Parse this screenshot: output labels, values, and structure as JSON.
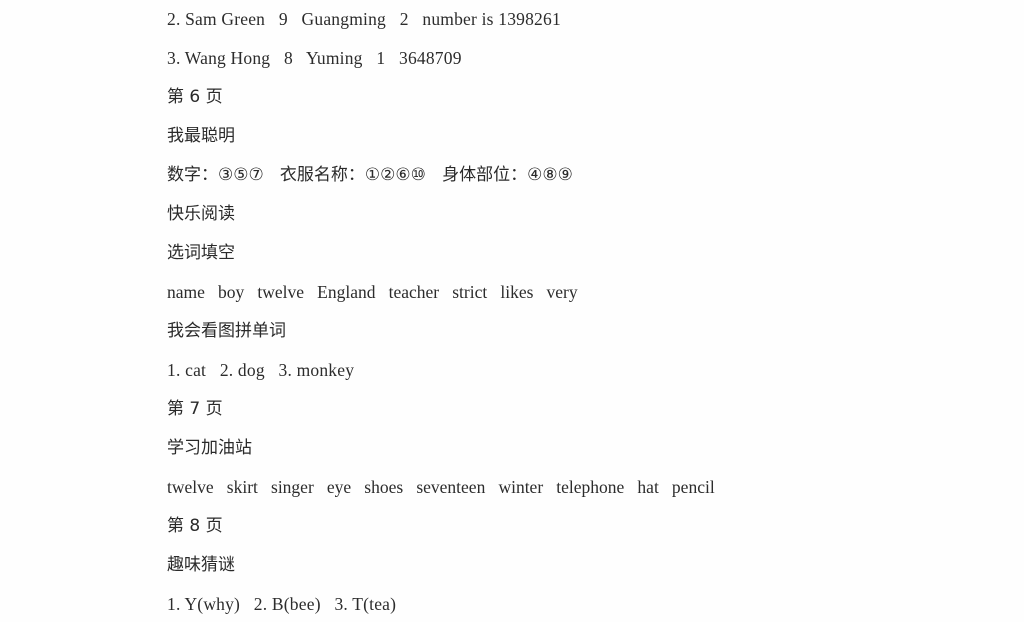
{
  "document": {
    "background_color": "#fefefe",
    "text_color": "#2b2b2b",
    "lines": [
      {
        "id": "answer-row-2",
        "text": "2. Sam Green   9   Guangming   2   number is 1398261"
      },
      {
        "id": "answer-row-3",
        "text": "3. Wang Hong   8   Yuming   1   3648709"
      },
      {
        "id": "page-heading-6",
        "text": "第 6 页"
      },
      {
        "id": "section-wozuicongming",
        "text": "我最聪明"
      },
      {
        "id": "categories-answer",
        "text": "数字：③⑤⑦   衣服名称：①②⑥⑩   身体部位：④⑧⑨"
      },
      {
        "id": "section-kuaileyuedu",
        "text": "快乐阅读"
      },
      {
        "id": "section-xuancitiankong",
        "text": "选词填空"
      },
      {
        "id": "word-bank-1",
        "text": "name   boy   twelve   England   teacher   strict   likes   very"
      },
      {
        "id": "section-kantupindanci",
        "text": "我会看图拼单词"
      },
      {
        "id": "picture-words-answer",
        "text": "1. cat   2. dog   3. monkey"
      },
      {
        "id": "page-heading-7",
        "text": "第 7 页"
      },
      {
        "id": "section-xuexijiayouzhan",
        "text": "学习加油站"
      },
      {
        "id": "word-bank-2",
        "text": "twelve   skirt   singer   eye   shoes   seventeen   winter   telephone   hat   pencil"
      },
      {
        "id": "page-heading-8",
        "text": "第 8 页"
      },
      {
        "id": "section-quweicaimi",
        "text": "趣味猜谜"
      },
      {
        "id": "riddle-answer",
        "text": "1. Y(why)   2. B(bee)   3. T(tea)"
      }
    ]
  }
}
